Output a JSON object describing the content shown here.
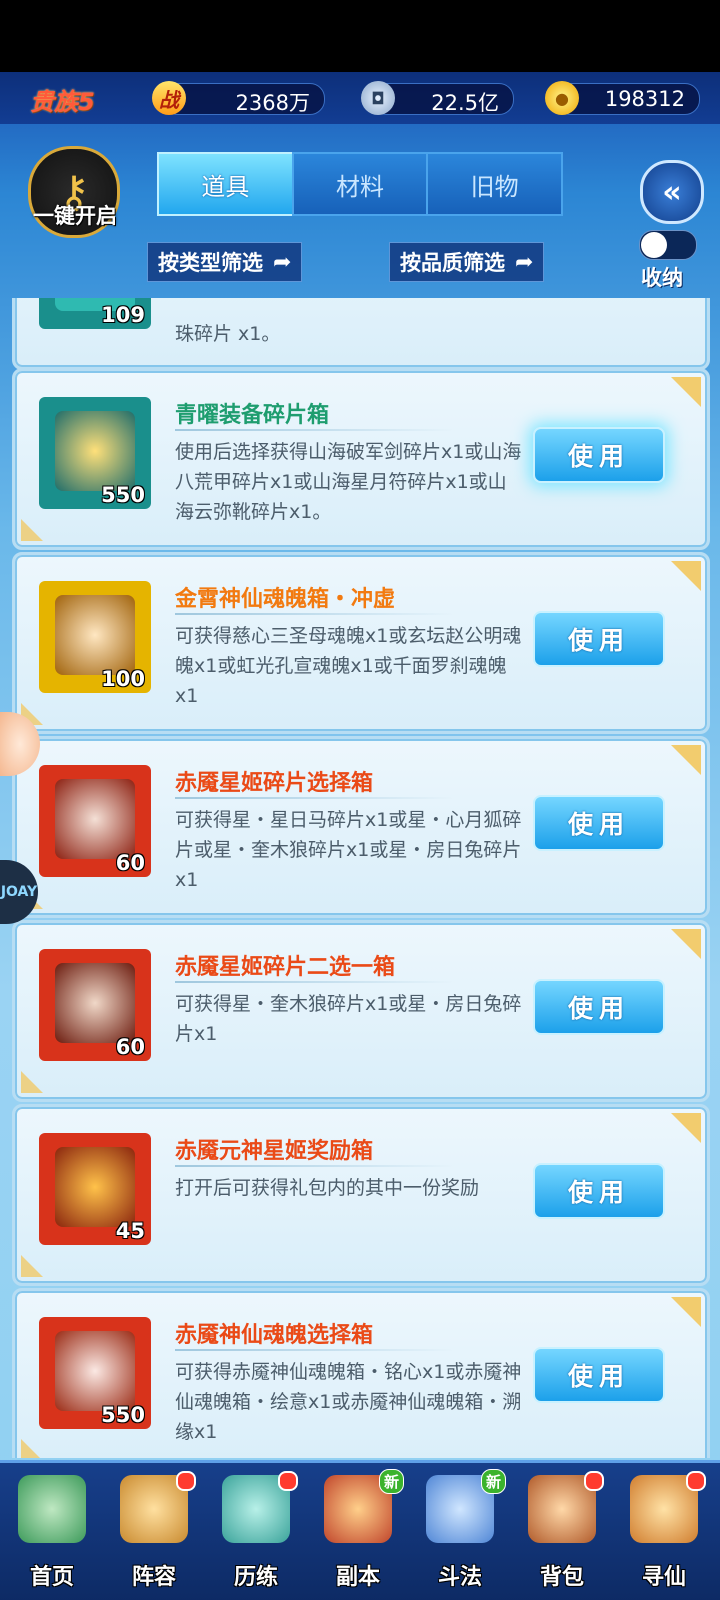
{
  "topbar": {
    "noble_label": "贵族5",
    "power_icon": "战",
    "power_value": "2368万",
    "coin_value": "22.5亿",
    "gold_value": "198312"
  },
  "header": {
    "one_key_open": "一键开启",
    "tabs": [
      {
        "label": "道具",
        "active": true
      },
      {
        "label": "材料",
        "active": false
      },
      {
        "label": "旧物",
        "active": false
      }
    ],
    "filter_type": "按类型筛选",
    "filter_quality": "按品质筛选",
    "collapse_label": "收纳"
  },
  "items": [
    {
      "name": "",
      "count": "109",
      "desc": "珠碎片 x1。",
      "partial": true
    },
    {
      "name": "青曜装备碎片箱",
      "name_color": "green",
      "count": "550",
      "desc": "使用后选择获得山海破军剑碎片x1或山海八荒甲碎片x1或山海星月符碎片x1或山海云弥靴碎片x1。",
      "button": "使用",
      "thumb_bg": "#1a8f8c"
    },
    {
      "name": "金霄神仙魂魄箱・冲虚",
      "name_color": "orange",
      "count": "100",
      "desc": "可获得慈心三圣母魂魄x1或玄坛赵公明魂魄x1或虹光孔宣魂魄x1或千面罗刹魂魄x1",
      "button": "使用",
      "thumb_bg": "#e5b400"
    },
    {
      "name": "赤魇星姬碎片选择箱",
      "name_color": "red",
      "count": "60",
      "desc": "可获得星・星日马碎片x1或星・心月狐碎片或星・奎木狼碎片x1或星・房日兔碎片x1",
      "button": "使用",
      "thumb_bg": "#d8331b"
    },
    {
      "name": "赤魇星姬碎片二选一箱",
      "name_color": "red",
      "count": "60",
      "desc": "可获得星・奎木狼碎片x1或星・房日兔碎片x1",
      "button": "使用",
      "thumb_bg": "#d8331b"
    },
    {
      "name": "赤魇元神星姬奖励箱",
      "name_color": "red",
      "count": "45",
      "desc": "打开后可获得礼包内的其中一份奖励",
      "button": "使用",
      "thumb_bg": "#d8331b"
    },
    {
      "name": "赤魇神仙魂魄选择箱",
      "name_color": "red",
      "count": "550",
      "desc": "可获得赤魇神仙魂魄箱・铭心x1或赤魇神仙魂魄箱・绘意x1或赤魇神仙魂魄箱・溯缘x1",
      "button": "使用",
      "thumb_bg": "#d8331b"
    }
  ],
  "float_logo_text": "JOAY",
  "nav": [
    {
      "label": "首页",
      "dot": false,
      "new": false,
      "color": "#3c9a5a"
    },
    {
      "label": "阵容",
      "dot": true,
      "new": false,
      "color": "#c98a2f"
    },
    {
      "label": "历练",
      "dot": true,
      "new": false,
      "color": "#3aa39a"
    },
    {
      "label": "副本",
      "dot": false,
      "new": true,
      "new_label": "新",
      "color": "#c0452b"
    },
    {
      "label": "斗法",
      "dot": false,
      "new": true,
      "new_label": "新",
      "color": "#4f86d6"
    },
    {
      "label": "背包",
      "dot": true,
      "new": false,
      "color": "#b05a2a"
    },
    {
      "label": "寻仙",
      "dot": true,
      "new": false,
      "color": "#d07d2e"
    }
  ]
}
